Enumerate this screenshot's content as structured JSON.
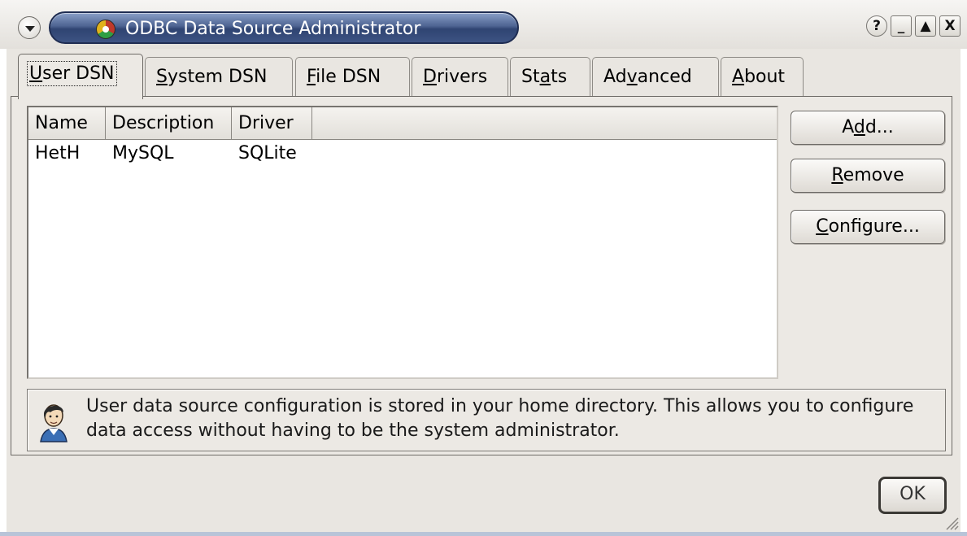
{
  "window": {
    "title": "ODBC Data Source Administrator",
    "buttons": {
      "help": "?",
      "minimize": "_",
      "maximize": "▲",
      "close": "X"
    }
  },
  "tabs": [
    {
      "label": "User DSN",
      "pre": "",
      "mnemonic": "U",
      "post": "ser DSN",
      "active": true
    },
    {
      "label": "System DSN",
      "pre": "",
      "mnemonic": "S",
      "post": "ystem DSN",
      "active": false
    },
    {
      "label": "File DSN",
      "pre": "",
      "mnemonic": "F",
      "post": "ile DSN",
      "active": false
    },
    {
      "label": "Drivers",
      "pre": "",
      "mnemonic": "D",
      "post": "rivers",
      "active": false
    },
    {
      "label": "Stats",
      "pre": "St",
      "mnemonic": "a",
      "post": "ts",
      "active": false
    },
    {
      "label": "Advanced",
      "pre": "Ad",
      "mnemonic": "v",
      "post": "anced",
      "active": false
    },
    {
      "label": "About",
      "pre": "",
      "mnemonic": "A",
      "post": "bout",
      "active": false
    }
  ],
  "datasources": {
    "columns": [
      "Name",
      "Description",
      "Driver"
    ],
    "rows": [
      {
        "name": "HetH",
        "description": "MySQL",
        "driver": "SQLite"
      }
    ]
  },
  "actions": {
    "add": {
      "pre": "A",
      "mnemonic": "d",
      "post": "d..."
    },
    "remove": {
      "pre": "",
      "mnemonic": "R",
      "post": "emove"
    },
    "configure": {
      "pre": "",
      "mnemonic": "C",
      "post": "onfigure..."
    }
  },
  "info": {
    "text": "User data source configuration is stored in your home directory. This allows you to configure data access without having to be the system administrator."
  },
  "footer": {
    "ok_label": "OK"
  }
}
